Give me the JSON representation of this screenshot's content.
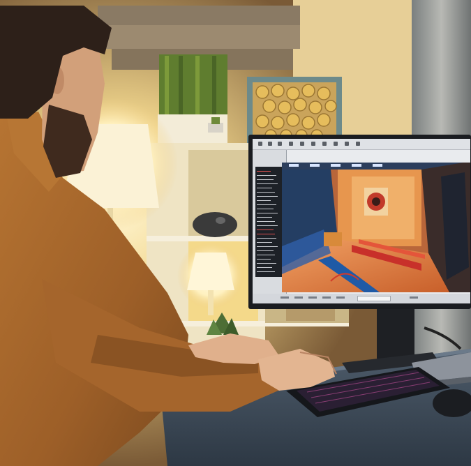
{
  "scene": {
    "description_none": "",
    "colors": {
      "sweater": "#a8692e",
      "wall_warm": "#e9d49a",
      "desk": "#3b4a5a",
      "lamp_glow": "#fff3c8",
      "monitor_bezel": "#1a1c20",
      "viewport_orange": "#e08a3c",
      "viewport_floor_blue": "#1f5aa6"
    },
    "icons": [
      "desk-lamp-icon",
      "plant-icon",
      "keyboard-icon",
      "mouse-icon",
      "laptop-icon"
    ]
  }
}
